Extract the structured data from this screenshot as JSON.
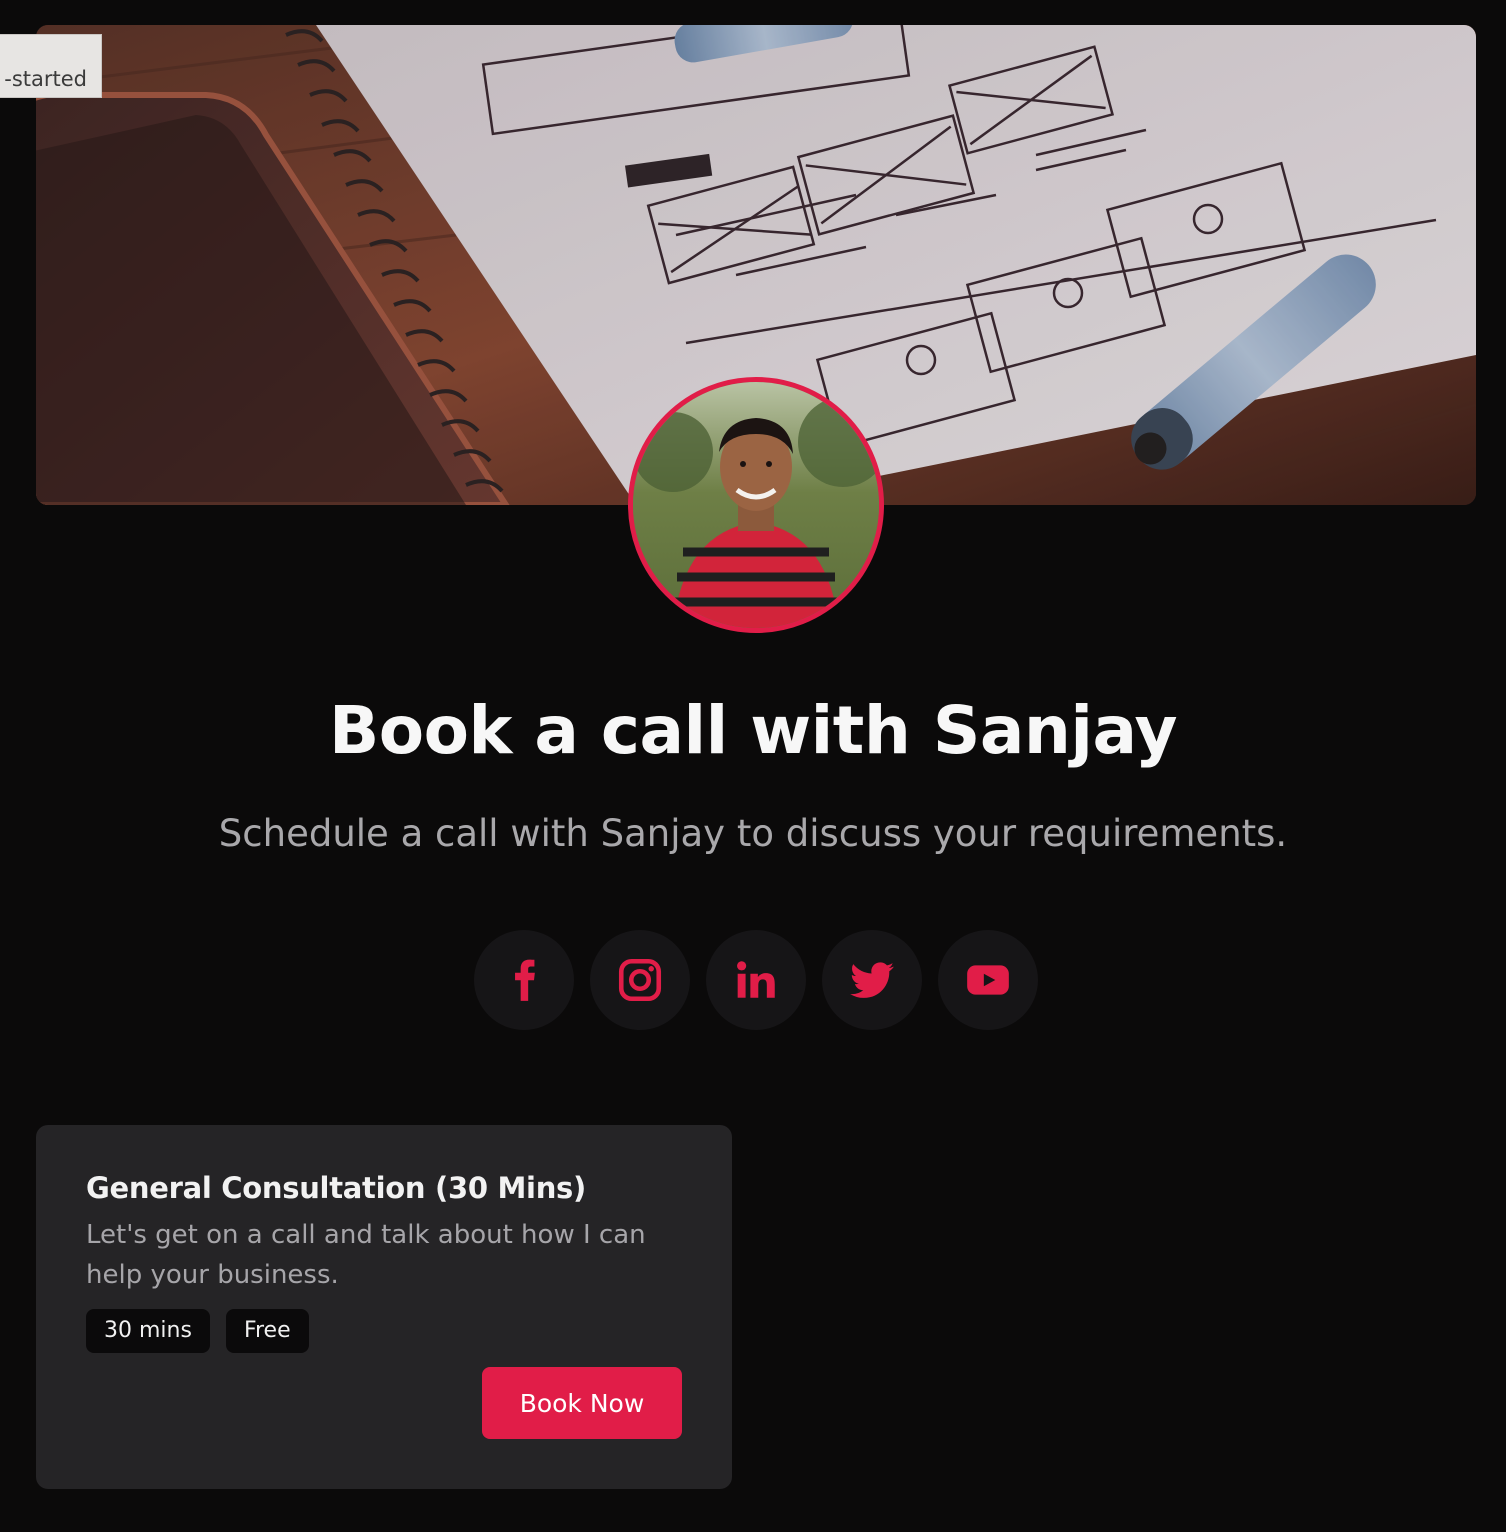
{
  "corner_tag": "-started",
  "header": {
    "title": "Book a call with Sanjay",
    "subtitle": "Schedule a call with Sanjay to discuss your requirements."
  },
  "socials": [
    {
      "name": "facebook",
      "icon": "facebook-icon"
    },
    {
      "name": "instagram",
      "icon": "instagram-icon"
    },
    {
      "name": "linkedin",
      "icon": "linkedin-icon"
    },
    {
      "name": "twitter",
      "icon": "twitter-icon"
    },
    {
      "name": "youtube",
      "icon": "youtube-icon"
    }
  ],
  "service": {
    "title": "General Consultation (30 Mins)",
    "description": "Let's get on a call and talk about how I can help your business.",
    "duration": "30 mins",
    "price": "Free",
    "cta": "Book Now"
  },
  "colors": {
    "accent": "#e11d48",
    "background": "#0b0a0a",
    "card": "#252426",
    "social_bg": "#161517"
  }
}
